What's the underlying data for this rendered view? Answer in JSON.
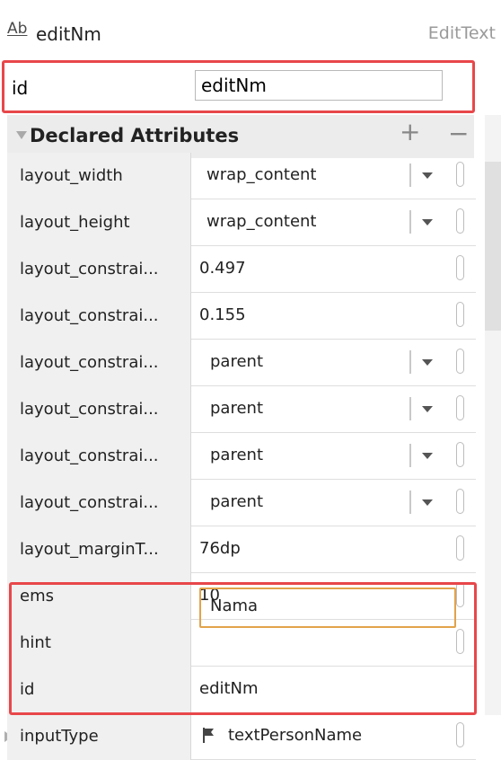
{
  "header": {
    "component_name": "editNm",
    "component_type": "EditText",
    "icon": "text-field-icon"
  },
  "id_field": {
    "label": "id",
    "value": "editNm"
  },
  "section": {
    "title": "Declared Attributes",
    "add": "+",
    "remove": "−"
  },
  "attributes": [
    {
      "name": "layout_width",
      "value": "wrap_content",
      "dropdown": true
    },
    {
      "name": "layout_height",
      "value": "wrap_content",
      "dropdown": true
    },
    {
      "name": "layout_constrai...",
      "value": "0.497",
      "dropdown": false
    },
    {
      "name": "layout_constrai...",
      "value": "0.155",
      "dropdown": false
    },
    {
      "name": "layout_constrai...",
      "value": "parent",
      "dropdown": true
    },
    {
      "name": "layout_constrai...",
      "value": "parent",
      "dropdown": true
    },
    {
      "name": "layout_constrai...",
      "value": "parent",
      "dropdown": true
    },
    {
      "name": "layout_constrai...",
      "value": "parent",
      "dropdown": true
    },
    {
      "name": "layout_marginT...",
      "value": "76dp",
      "dropdown": false
    },
    {
      "name": "ems",
      "value": "10",
      "dropdown": false
    },
    {
      "name": "hint",
      "value": "Nama",
      "dropdown": false
    },
    {
      "name": "id",
      "value": "editNm",
      "dropdown": false
    },
    {
      "name": "inputType",
      "value": "textPersonName",
      "dropdown": false
    }
  ],
  "colors": {
    "highlight_red": "#e8474a",
    "focus_orange": "#e2a34b"
  }
}
